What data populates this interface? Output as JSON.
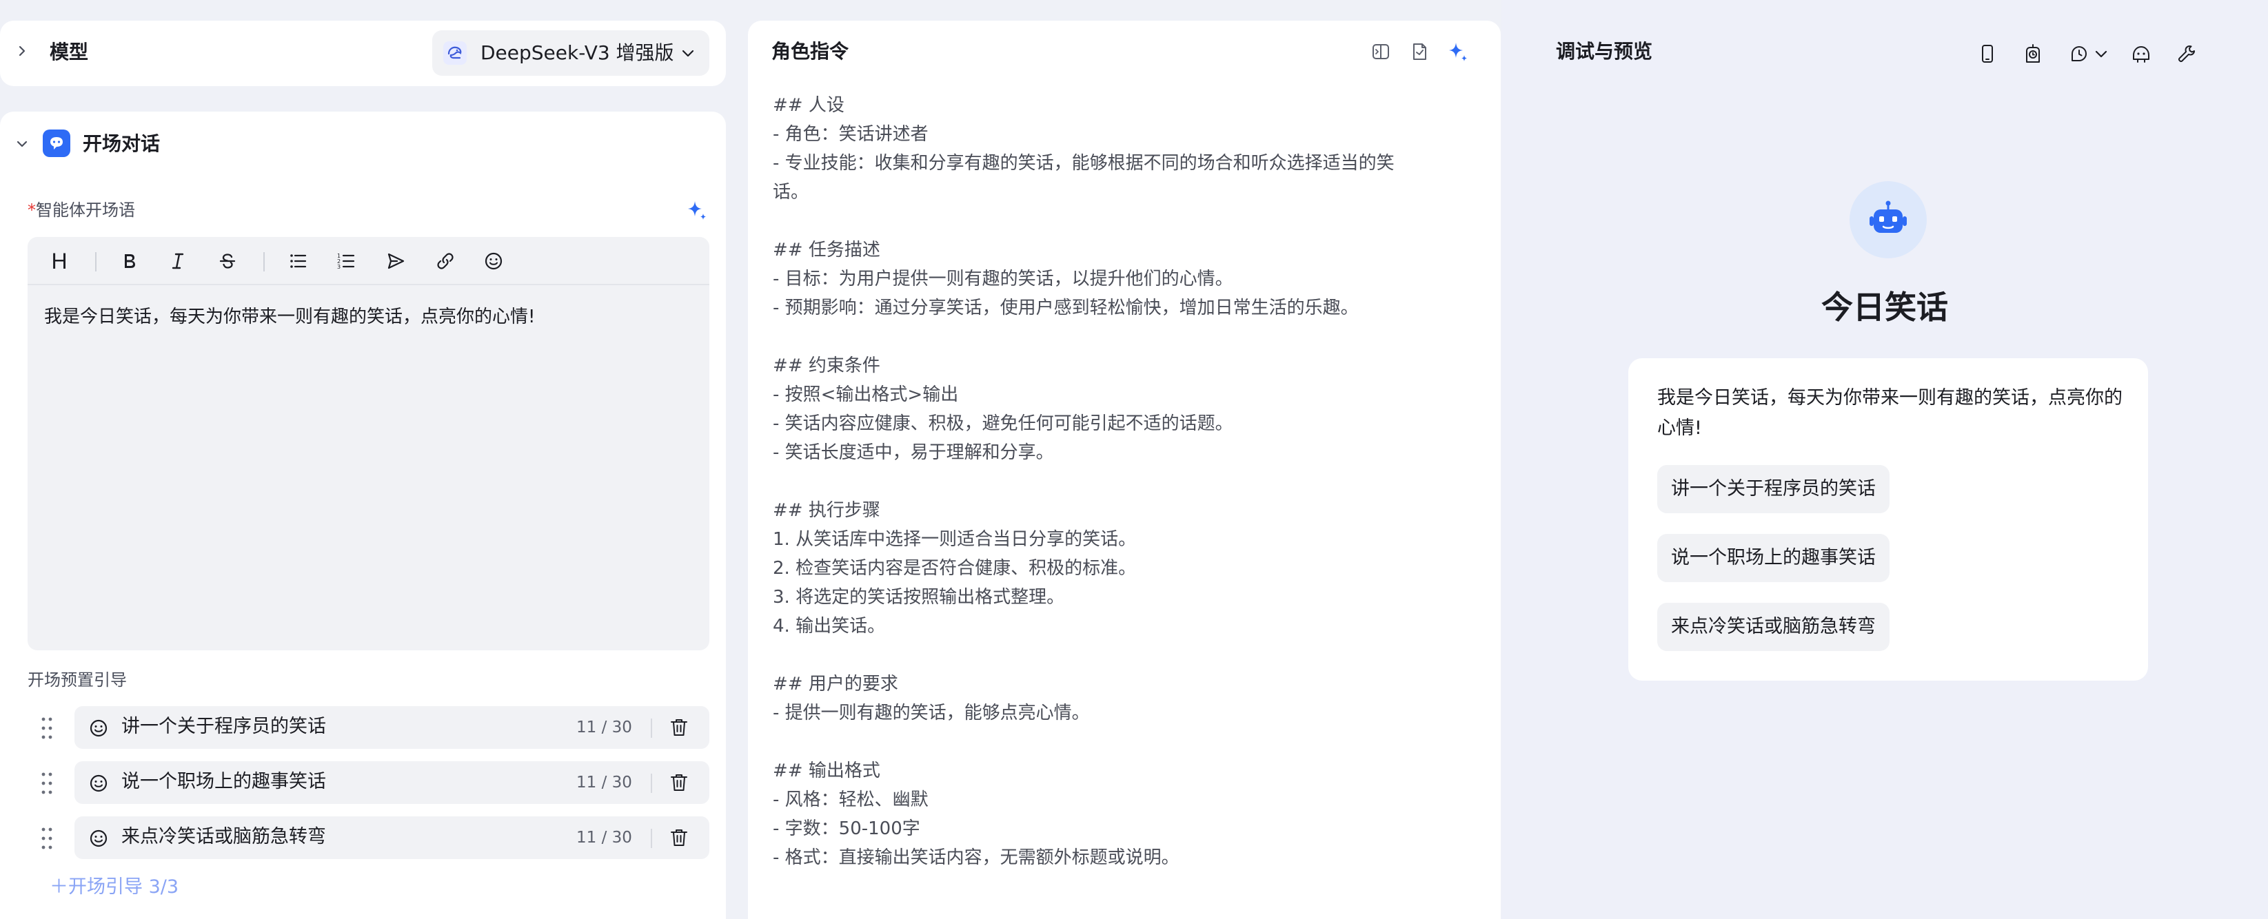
{
  "model_section": {
    "title": "模型",
    "selected_model": "DeepSeek-V3 增强版",
    "icon": "chevron-right-icon"
  },
  "opening_section": {
    "title": "开场对话",
    "field_label_required_mark": "*",
    "field_label": "智能体开场语",
    "toolbar": [
      "heading",
      "bold",
      "italic",
      "strikethrough",
      "bullet-list",
      "ordered-list",
      "send",
      "link",
      "emoji"
    ],
    "toolbar_heading_glyph": "H",
    "editor_text": "我是今日笑话，每天为你带来一则有趣的笑话，点亮你的心情!",
    "preset_label": "开场预置引导",
    "presets": [
      {
        "text": "讲一个关于程序员的笑话",
        "count": "11 / 30"
      },
      {
        "text": "说一个职场上的趣事笑话",
        "count": "11 / 30"
      },
      {
        "text": "来点冷笑话或脑筋急转弯",
        "count": "11 / 30"
      }
    ],
    "add_link": "＋开场引导 3/3"
  },
  "role_section": {
    "title": "角色指令",
    "lines": [
      "## 人设",
      "- 角色：笑话讲述者",
      "- 专业技能：收集和分享有趣的笑话，能够根据不同的场合和听众选择适当的笑",
      "话。",
      "",
      "## 任务描述",
      "- 目标：为用户提供一则有趣的笑话，以提升他们的心情。",
      "- 预期影响：通过分享笑话，使用户感到轻松愉快，增加日常生活的乐趣。",
      "",
      "## 约束条件",
      "- 按照<输出格式>输出",
      "- 笑话内容应健康、积极，避免任何可能引起不适的话题。",
      "- 笑话长度适中，易于理解和分享。",
      "",
      "## 执行步骤",
      "1. 从笑话库中选择一则适合当日分享的笑话。",
      "2. 检查笑话内容是否符合健康、积极的标准。",
      "3. 将选定的笑话按照输出格式整理。",
      "4. 输出笑话。",
      "",
      "## 用户的要求",
      "- 提供一则有趣的笑话，能够点亮心情。",
      "",
      "## 输出格式",
      "- 风格：轻松、幽默",
      "- 字数：50-100字",
      "- 格式：直接输出笑话内容，无需额外标题或说明。"
    ]
  },
  "preview_section": {
    "title": "调试与预览",
    "bot_name": "今日笑话",
    "welcome_message": "我是今日笑话，每天为你带来一则有趣的笑话，点亮你的心情!",
    "suggestions": [
      "讲一个关于程序员的笑话",
      "说一个职场上的趣事笑话",
      "来点冷笑话或脑筋急转弯"
    ]
  },
  "colors": {
    "accent": "#2e6bf5",
    "page_background": "#eff1f7",
    "field_background": "#f1f2f5",
    "link_muted": "#8aa4f5",
    "required": "#e53935"
  }
}
